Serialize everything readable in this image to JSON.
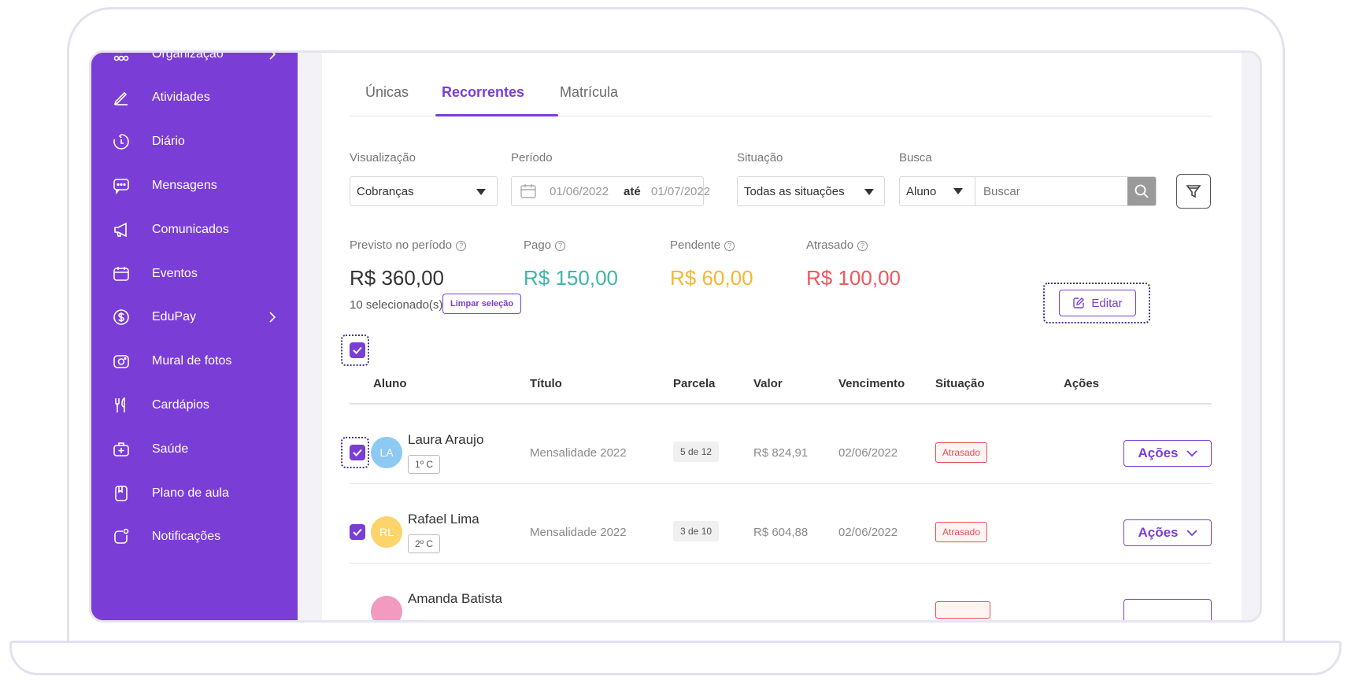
{
  "sidebar": {
    "items": [
      {
        "label": "Organização",
        "icon": "org-icon"
      },
      {
        "label": "Atividades",
        "icon": "pencil-icon"
      },
      {
        "label": "Diário",
        "icon": "diary-icon"
      },
      {
        "label": "Mensagens",
        "icon": "chat-icon"
      },
      {
        "label": "Comunicados",
        "icon": "megaphone-icon"
      },
      {
        "label": "Eventos",
        "icon": "calendar-icon"
      },
      {
        "label": "EduPay",
        "icon": "dollar-icon"
      },
      {
        "label": "Mural de fotos",
        "icon": "camera-icon"
      },
      {
        "label": "Cardápios",
        "icon": "cutlery-icon"
      },
      {
        "label": "Saúde",
        "icon": "medkit-icon"
      },
      {
        "label": "Plano de aula",
        "icon": "lesson-plan-icon"
      },
      {
        "label": "Notificações",
        "icon": "notification-icon"
      }
    ]
  },
  "tabs": [
    {
      "label": "Únicas"
    },
    {
      "label": "Recorrentes"
    },
    {
      "label": "Matrícula"
    }
  ],
  "filters": {
    "view_label": "Visualização",
    "view_value": "Cobranças",
    "period_label": "Período",
    "period_from": "01/06/2022",
    "period_sep": "até",
    "period_to": "01/07/2022",
    "status_label": "Situação",
    "status_value": "Todas as situações",
    "search_label": "Busca",
    "search_scope": "Aluno",
    "search_placeholder": "Buscar"
  },
  "summary": {
    "expected_label": "Previsto no período",
    "expected_value": "R$ 360,00",
    "paid_label": "Pago",
    "paid_value": "R$ 150,00",
    "pending_label": "Pendente",
    "pending_value": "R$ 60,00",
    "late_label": "Atrasado",
    "late_value": "R$ 100,00"
  },
  "colors": {
    "accent": "#7a3dd6",
    "paid": "#3fb6a8",
    "pending": "#f5b731",
    "late": "#f0575f"
  },
  "selection": {
    "count_text": "10 selecionado(s)",
    "clear_label": "Limpar seleção",
    "edit_label": "Editar"
  },
  "table": {
    "headers": {
      "student": "Aluno",
      "title": "Título",
      "installment": "Parcela",
      "value": "Valor",
      "due": "Vencimento",
      "status": "Situação",
      "actions": "Ações"
    },
    "rows": [
      {
        "initials": "LA",
        "name": "Laura Araujo",
        "class": "1º C",
        "title": "Mensalidade 2022",
        "installment": "5 de 12",
        "value": "R$ 824,91",
        "due": "02/06/2022",
        "status": "Atrasado",
        "actions": "Ações",
        "avatar_color": "#8cc9f3"
      },
      {
        "initials": "RL",
        "name": "Rafael Lima",
        "class": "2º C",
        "title": "Mensalidade 2022",
        "installment": "3 de 10",
        "value": "R$ 604,88",
        "due": "02/06/2022",
        "status": "Atrasado",
        "actions": "Ações",
        "avatar_color": "#fbd46b"
      },
      {
        "initials": "",
        "name": "Amanda Batista",
        "avatar_color": "#f29ac0"
      }
    ]
  }
}
